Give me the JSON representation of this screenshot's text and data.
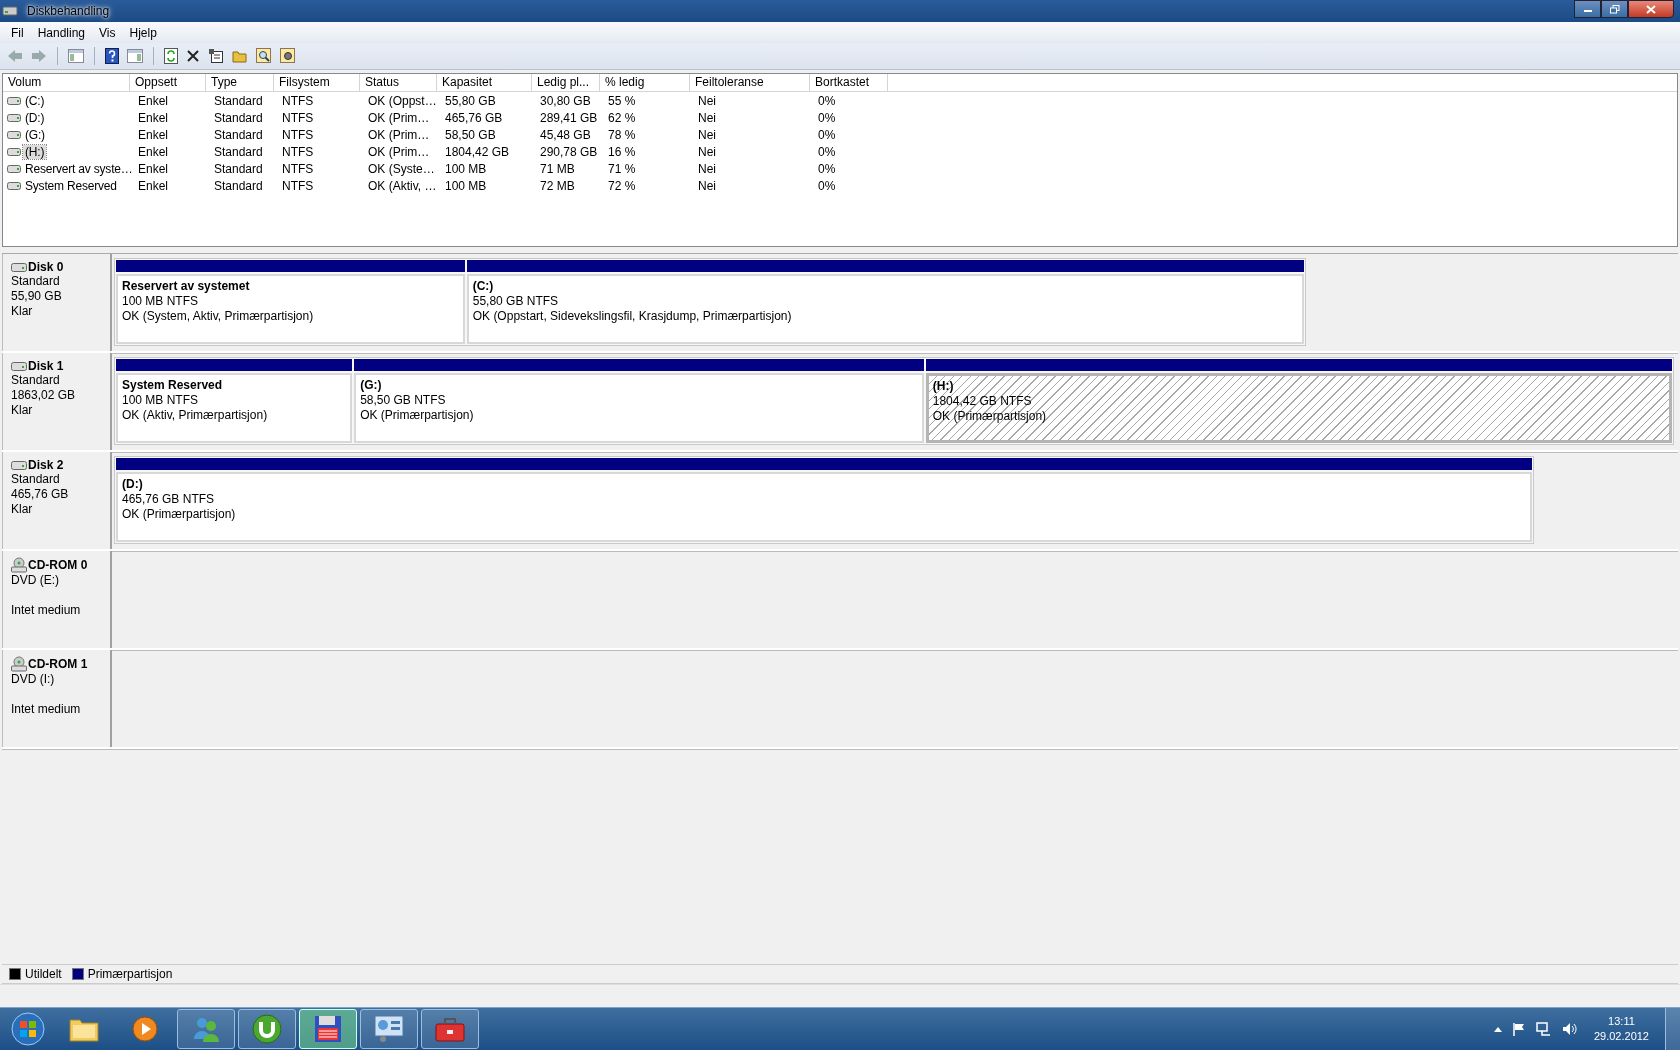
{
  "window": {
    "title": "Diskbehandling"
  },
  "menu": [
    "Fil",
    "Handling",
    "Vis",
    "Hjelp"
  ],
  "volume_table": {
    "columns": [
      "Volum",
      "Oppsett",
      "Type",
      "Filsystem",
      "Status",
      "Kapasitet",
      "Ledig pl...",
      "% ledig",
      "Feiltoleranse",
      "Bortkastet"
    ],
    "rows": [
      {
        "selected": false,
        "cells": [
          "(C:)",
          "Enkel",
          "Standard",
          "NTFS",
          "OK (Oppst…",
          "55,80 GB",
          "30,80 GB",
          "55 %",
          "Nei",
          "0%"
        ]
      },
      {
        "selected": false,
        "cells": [
          "(D:)",
          "Enkel",
          "Standard",
          "NTFS",
          "OK (Prim…",
          "465,76 GB",
          "289,41 GB",
          "62 %",
          "Nei",
          "0%"
        ]
      },
      {
        "selected": false,
        "cells": [
          "(G:)",
          "Enkel",
          "Standard",
          "NTFS",
          "OK (Prim…",
          "58,50 GB",
          "45,48 GB",
          "78 %",
          "Nei",
          "0%"
        ]
      },
      {
        "selected": true,
        "cells": [
          "(H:)",
          "Enkel",
          "Standard",
          "NTFS",
          "OK (Prim…",
          "1804,42 GB",
          "290,78 GB",
          "16 %",
          "Nei",
          "0%"
        ]
      },
      {
        "selected": false,
        "cells": [
          "Reservert av syste…",
          "Enkel",
          "Standard",
          "NTFS",
          "OK (Syste…",
          "100 MB",
          "71 MB",
          "71 %",
          "Nei",
          "0%"
        ]
      },
      {
        "selected": false,
        "cells": [
          "System Reserved",
          "Enkel",
          "Standard",
          "NTFS",
          "OK (Aktiv, …",
          "100 MB",
          "72 MB",
          "72 %",
          "Nei",
          "0%"
        ]
      }
    ]
  },
  "disks": [
    {
      "kind": "disk",
      "name": "Disk 0",
      "lines": [
        "Standard",
        "55,90 GB",
        "Klar"
      ],
      "partitions": [
        {
          "name": "Reservert av systemet",
          "size": "100 MB NTFS",
          "status": "OK (System, Aktiv, Primærpartisjon)",
          "selected": false
        },
        {
          "name": "(C:)",
          "size": "55,80 GB NTFS",
          "status": "OK (Oppstart, Sidevekslingsfil, Krasjdump, Primærpartisjon)",
          "selected": false
        }
      ]
    },
    {
      "kind": "disk",
      "name": "Disk 1",
      "lines": [
        "Standard",
        "1863,02 GB",
        "Klar"
      ],
      "partitions": [
        {
          "name": "System Reserved",
          "size": "100 MB NTFS",
          "status": "OK (Aktiv, Primærpartisjon)",
          "selected": false
        },
        {
          "name": "(G:)",
          "size": "58,50 GB NTFS",
          "status": "OK (Primærpartisjon)",
          "selected": false
        },
        {
          "name": "(H:)",
          "size": "1804,42 GB NTFS",
          "status": "OK (Primærpartisjon)",
          "selected": true
        }
      ]
    },
    {
      "kind": "disk",
      "name": "Disk 2",
      "lines": [
        "Standard",
        "465,76 GB",
        "Klar"
      ],
      "partitions": [
        {
          "name": "(D:)",
          "size": "465,76 GB NTFS",
          "status": "OK (Primærpartisjon)",
          "selected": false
        }
      ]
    },
    {
      "kind": "cdrom",
      "name": "CD-ROM 0",
      "lines": [
        "DVD (E:)",
        "Intet medium"
      ]
    },
    {
      "kind": "cdrom",
      "name": "CD-ROM 1",
      "lines": [
        "DVD (I:)",
        "Intet medium"
      ]
    }
  ],
  "legend": [
    {
      "label": "Utildelt",
      "color": "#000000"
    },
    {
      "label": "Primærpartisjon",
      "color": "#000080"
    }
  ],
  "taskbar": {
    "apps": [
      {
        "kind": "folder",
        "selected": false
      },
      {
        "kind": "media",
        "selected": false
      },
      {
        "kind": "people",
        "selected": false
      },
      {
        "kind": "torrent",
        "selected": false
      },
      {
        "kind": "floppy",
        "selected": true
      },
      {
        "kind": "panel",
        "selected": false
      },
      {
        "kind": "toolbox",
        "selected": false
      }
    ],
    "time": "13:11",
    "date": "29.02.2012"
  }
}
